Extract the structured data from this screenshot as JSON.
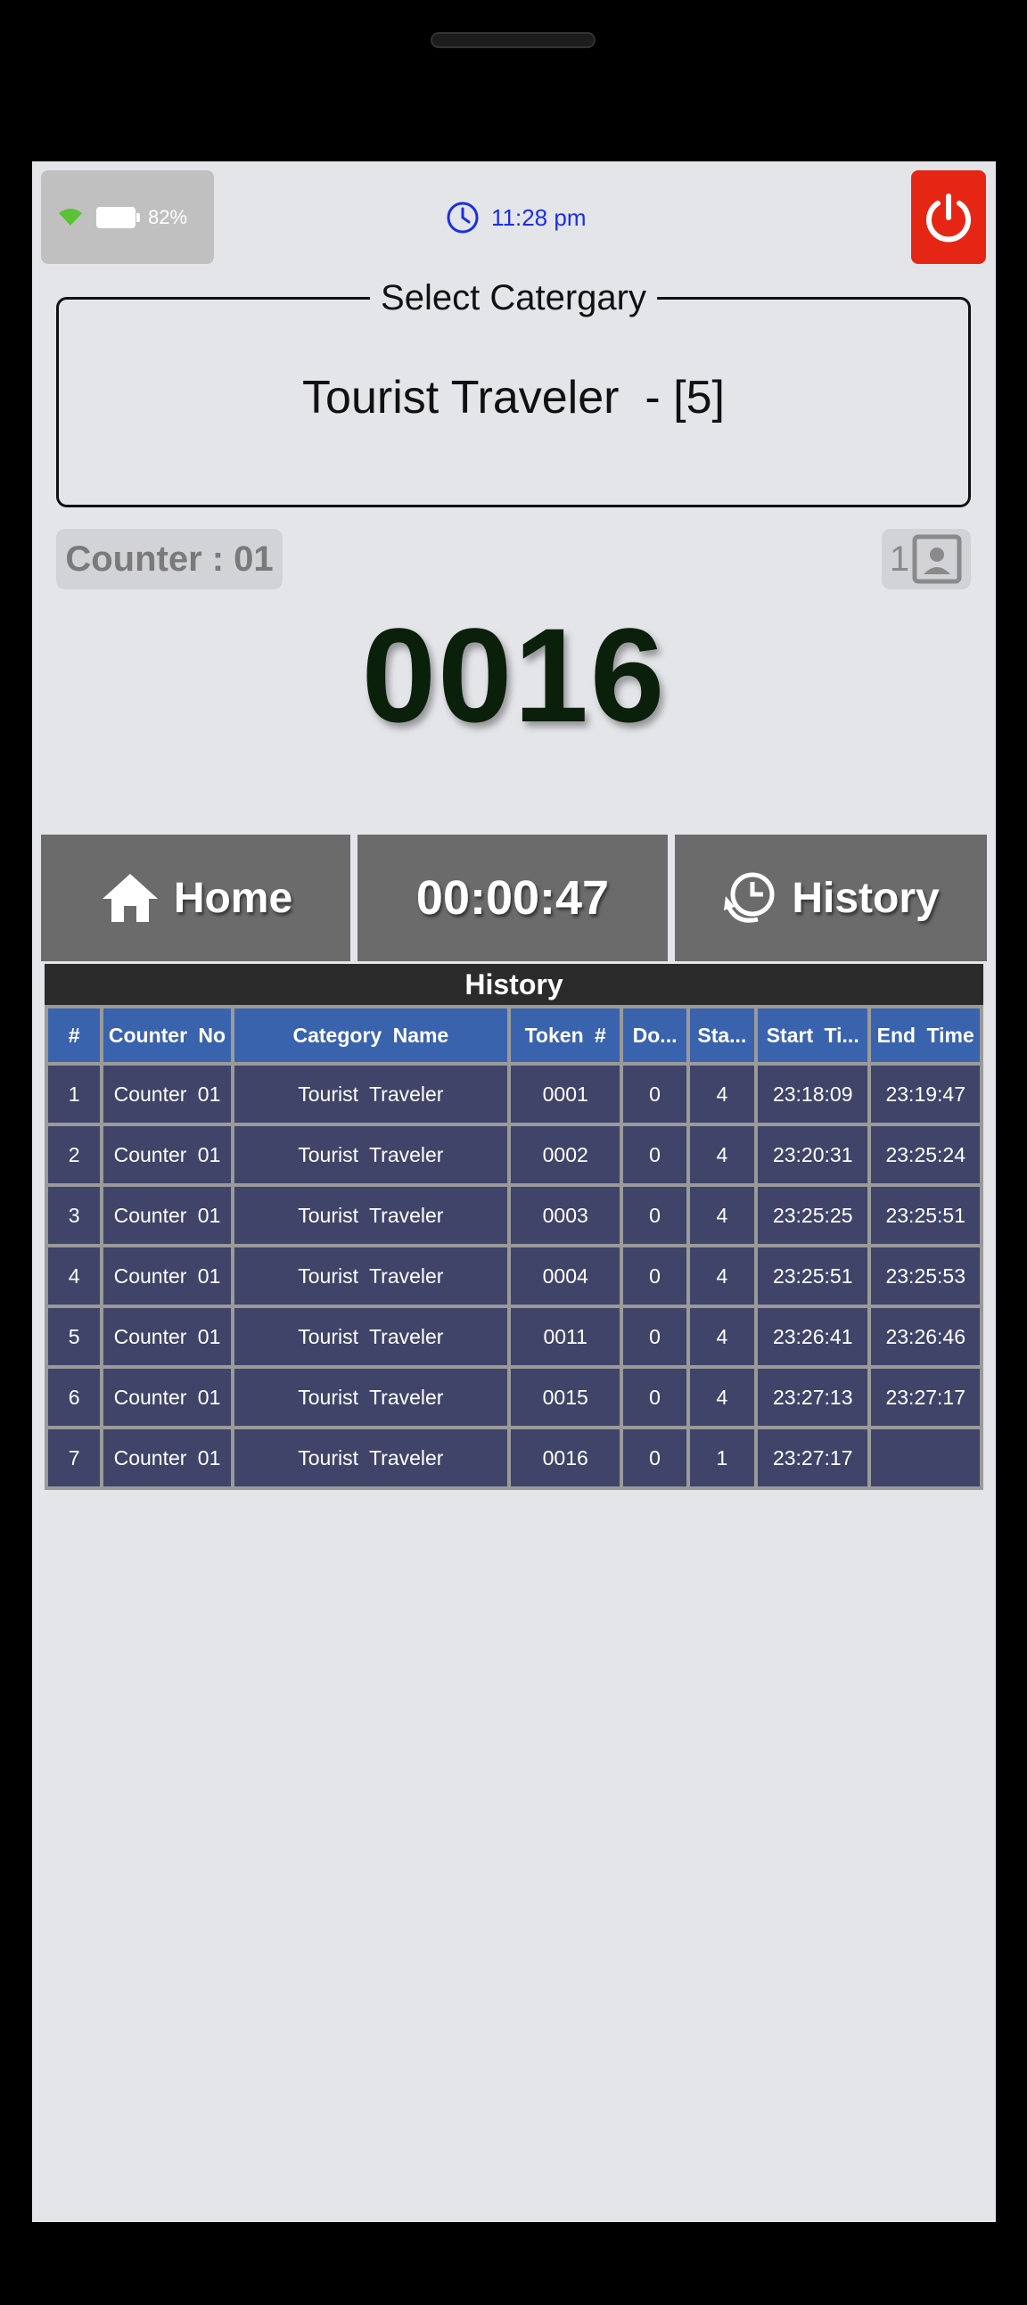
{
  "status": {
    "battery": "82%",
    "time": "11:28 pm"
  },
  "category": {
    "legend": "Select Catergary",
    "selected": "Tourist Traveler  - [5]"
  },
  "counter": {
    "label": "Counter : 01",
    "profile_count": "1"
  },
  "token": {
    "current": "0016"
  },
  "actions": {
    "home_label": "Home",
    "timer": "00:00:47",
    "history_label": "History"
  },
  "history": {
    "title": "History",
    "columns": [
      "#",
      "Counter  No",
      "Category  Name",
      "Token  #",
      "Do...",
      "Sta...",
      "Start  Ti...",
      "End  Time"
    ],
    "rows": [
      [
        "1",
        "Counter  01",
        "Tourist  Traveler",
        "0001",
        "0",
        "4",
        "23:18:09",
        "23:19:47"
      ],
      [
        "2",
        "Counter  01",
        "Tourist  Traveler",
        "0002",
        "0",
        "4",
        "23:20:31",
        "23:25:24"
      ],
      [
        "3",
        "Counter  01",
        "Tourist  Traveler",
        "0003",
        "0",
        "4",
        "23:25:25",
        "23:25:51"
      ],
      [
        "4",
        "Counter  01",
        "Tourist  Traveler",
        "0004",
        "0",
        "4",
        "23:25:51",
        "23:25:53"
      ],
      [
        "5",
        "Counter  01",
        "Tourist  Traveler",
        "0011",
        "0",
        "4",
        "23:26:41",
        "23:26:46"
      ],
      [
        "6",
        "Counter  01",
        "Tourist  Traveler",
        "0015",
        "0",
        "4",
        "23:27:13",
        "23:27:17"
      ],
      [
        "7",
        "Counter  01",
        "Tourist  Traveler",
        "0016",
        "0",
        "1",
        "23:27:17",
        ""
      ]
    ]
  },
  "icons": {
    "wifi": "wifi-icon",
    "battery": "battery-icon",
    "clock": "clock-icon",
    "power": "power-icon",
    "profile": "contact-card-icon",
    "home": "home-icon",
    "history": "history-icon"
  },
  "colors": {
    "accent_blue": "#1a2ee8",
    "power_red": "#e62615",
    "table_header": "#3a63ad",
    "table_cell": "#404468"
  }
}
